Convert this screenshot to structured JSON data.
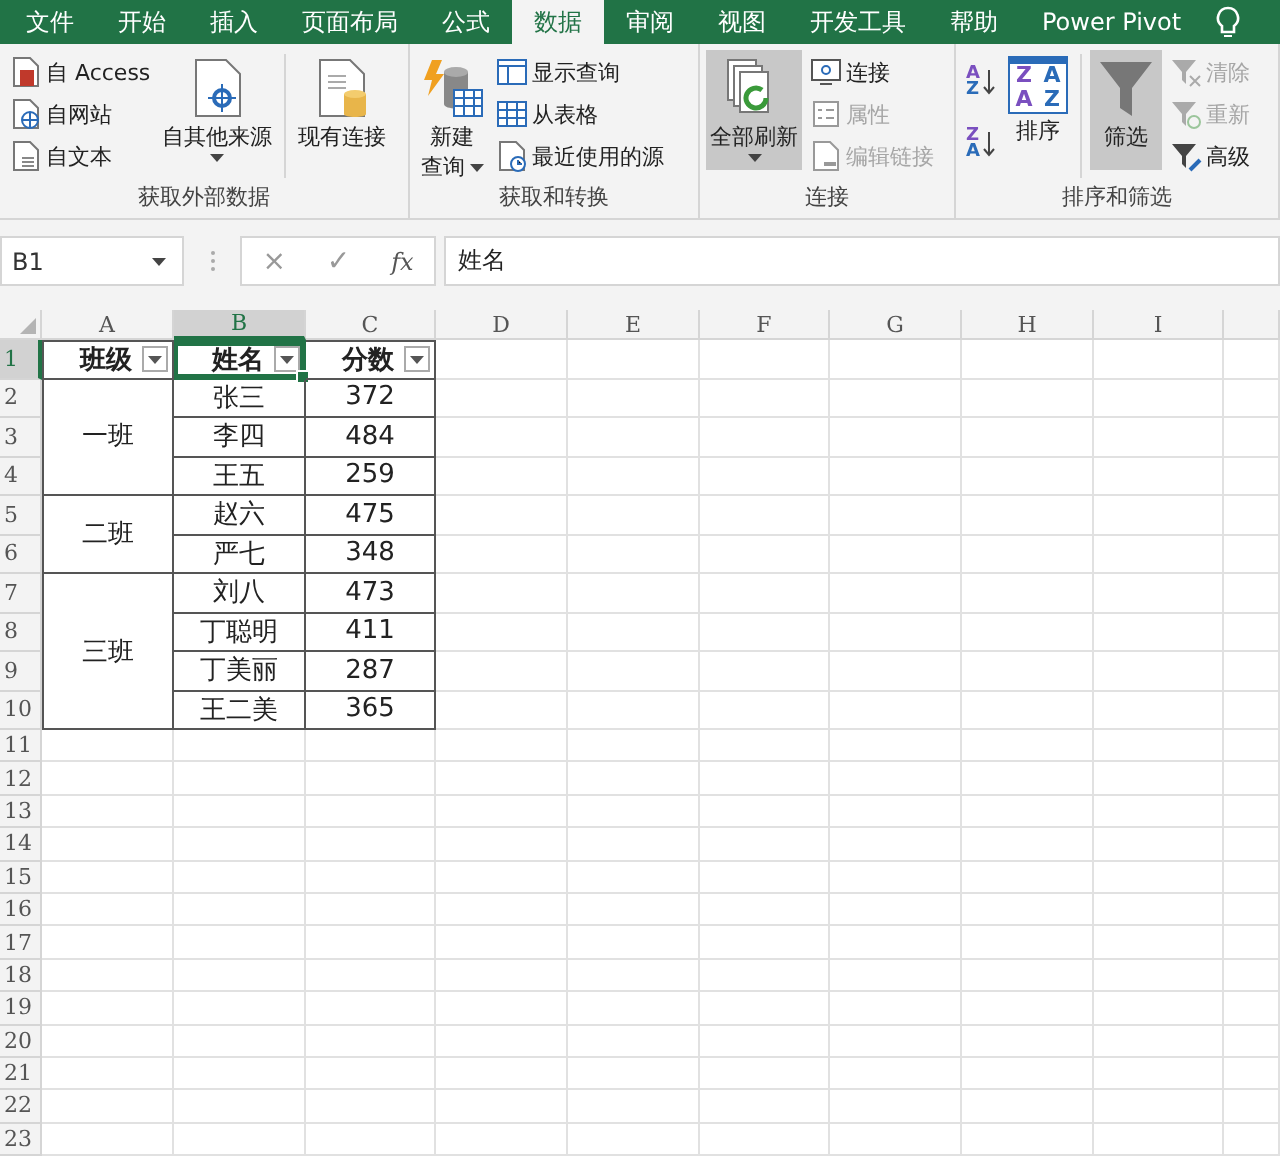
{
  "ribbon_tabs": [
    {
      "label": "文件",
      "selected": false
    },
    {
      "label": "开始",
      "selected": false
    },
    {
      "label": "插入",
      "selected": false
    },
    {
      "label": "页面布局",
      "selected": false
    },
    {
      "label": "公式",
      "selected": false
    },
    {
      "label": "数据",
      "selected": true
    },
    {
      "label": "审阅",
      "selected": false
    },
    {
      "label": "视图",
      "selected": false
    },
    {
      "label": "开发工具",
      "selected": false
    },
    {
      "label": "帮助",
      "selected": false
    },
    {
      "label": "Power Pivot",
      "selected": false
    }
  ],
  "ribbon_groups": [
    {
      "label": "获取外部数据",
      "columns": [
        {
          "kind": "stack",
          "items": [
            {
              "label": "自 Access",
              "disabled": false
            },
            {
              "label": "自网站",
              "disabled": false
            },
            {
              "label": "自文本",
              "disabled": false
            }
          ]
        },
        {
          "kind": "large",
          "lines": [
            "自其他来源"
          ],
          "dropdown": true,
          "highlighted": false
        },
        {
          "kind": "large",
          "lines": [
            "现有连接"
          ],
          "dropdown": false,
          "highlighted": false
        }
      ]
    },
    {
      "label": "获取和转换",
      "columns": [
        {
          "kind": "large",
          "lines": [
            "新建",
            "查询"
          ],
          "dropdown": true,
          "highlighted": false
        },
        {
          "kind": "stack",
          "items": [
            {
              "label": "显示查询",
              "disabled": false
            },
            {
              "label": "从表格",
              "disabled": false
            },
            {
              "label": "最近使用的源",
              "disabled": false
            }
          ]
        }
      ]
    },
    {
      "label": "连接",
      "columns": [
        {
          "kind": "large",
          "lines": [
            "全部刷新"
          ],
          "dropdown": true,
          "highlighted": true
        },
        {
          "kind": "stack",
          "items": [
            {
              "label": "连接",
              "disabled": false
            },
            {
              "label": "属性",
              "disabled": true
            },
            {
              "label": "编辑链接",
              "disabled": true
            }
          ]
        }
      ]
    },
    {
      "label": "排序和筛选",
      "columns": [
        {
          "kind": "sort_stack",
          "items": [
            {
              "glyphs": [
                "A",
                "Z"
              ]
            },
            {
              "glyphs": [
                "Z",
                "A"
              ]
            }
          ]
        },
        {
          "kind": "large",
          "lines": [
            "排序"
          ],
          "dropdown": false,
          "highlighted": false,
          "glyphs": [
            "Z",
            "A",
            "A",
            "Z"
          ]
        },
        {
          "kind": "large",
          "lines": [
            "筛选"
          ],
          "dropdown": false,
          "highlighted": true
        },
        {
          "kind": "stack",
          "items": [
            {
              "label": "清除",
              "disabled": true
            },
            {
              "label": "重新",
              "disabled": true
            },
            {
              "label": "高级",
              "disabled": false
            }
          ]
        }
      ]
    }
  ],
  "formula_bar": {
    "name_box": "B1",
    "cancel": "×",
    "enter": "✓",
    "function": "fx",
    "content": "姓名"
  },
  "sheet": {
    "columns": [
      {
        "label": "A",
        "selected": false
      },
      {
        "label": "B",
        "selected": true
      },
      {
        "label": "C",
        "selected": false
      },
      {
        "label": "D",
        "selected": false
      },
      {
        "label": "E",
        "selected": false
      },
      {
        "label": "F",
        "selected": false
      },
      {
        "label": "G",
        "selected": false
      },
      {
        "label": "H",
        "selected": false
      },
      {
        "label": "I",
        "selected": false
      }
    ],
    "rows": [
      {
        "label": "1",
        "selected": true
      },
      {
        "label": "2",
        "selected": false
      },
      {
        "label": "3",
        "selected": false
      },
      {
        "label": "4",
        "selected": false
      },
      {
        "label": "5",
        "selected": false
      },
      {
        "label": "6",
        "selected": false
      },
      {
        "label": "7",
        "selected": false
      },
      {
        "label": "8",
        "selected": false
      },
      {
        "label": "9",
        "selected": false
      },
      {
        "label": "10",
        "selected": false
      },
      {
        "label": "11",
        "selected": false
      },
      {
        "label": "12",
        "selected": false
      },
      {
        "label": "13",
        "selected": false
      },
      {
        "label": "14",
        "selected": false
      },
      {
        "label": "15",
        "selected": false
      },
      {
        "label": "16",
        "selected": false
      },
      {
        "label": "17",
        "selected": false
      },
      {
        "label": "18",
        "selected": false
      },
      {
        "label": "19",
        "selected": false
      },
      {
        "label": "20",
        "selected": false
      },
      {
        "label": "21",
        "selected": false
      },
      {
        "label": "22",
        "selected": false
      },
      {
        "label": "23",
        "selected": false
      }
    ],
    "header": [
      {
        "text": "班级",
        "filter": true,
        "selected": false
      },
      {
        "text": "姓名",
        "filter": true,
        "selected": true
      },
      {
        "text": "分数",
        "filter": true,
        "selected": false
      }
    ],
    "groups": [
      {
        "class": "一班",
        "members": [
          {
            "name": "张三",
            "score": "372"
          },
          {
            "name": "李四",
            "score": "484"
          },
          {
            "name": "王五",
            "score": "259"
          }
        ]
      },
      {
        "class": "二班",
        "members": [
          {
            "name": "赵六",
            "score": "475"
          },
          {
            "name": "严七",
            "score": "348"
          }
        ]
      },
      {
        "class": "三班",
        "members": [
          {
            "name": "刘八",
            "score": "473"
          },
          {
            "name": "丁聪明",
            "score": "411"
          },
          {
            "name": "丁美丽",
            "score": "287"
          },
          {
            "name": "王二美",
            "score": "365"
          }
        ]
      }
    ]
  }
}
